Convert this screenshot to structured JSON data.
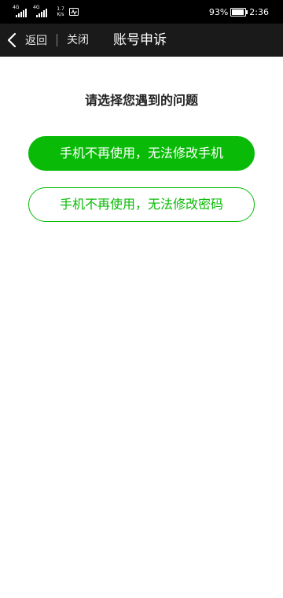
{
  "status_bar": {
    "signal_1_tag": "4G",
    "signal_2_tag": "4G",
    "speed_value": "1.7",
    "speed_unit": "K/s",
    "battery": "93%",
    "time": "2:36"
  },
  "nav": {
    "back_label": "返回",
    "close_label": "关闭",
    "title": "账号申诉"
  },
  "content": {
    "question": "请选择您遇到的问题",
    "options": [
      {
        "label": "手机不再使用，无法修改手机"
      },
      {
        "label": "手机不再使用，无法修改密码"
      }
    ]
  },
  "colors": {
    "accent": "#09bb07",
    "nav_background": "#1a1a1a",
    "status_background": "#000000"
  },
  "battery_level": 0.93
}
